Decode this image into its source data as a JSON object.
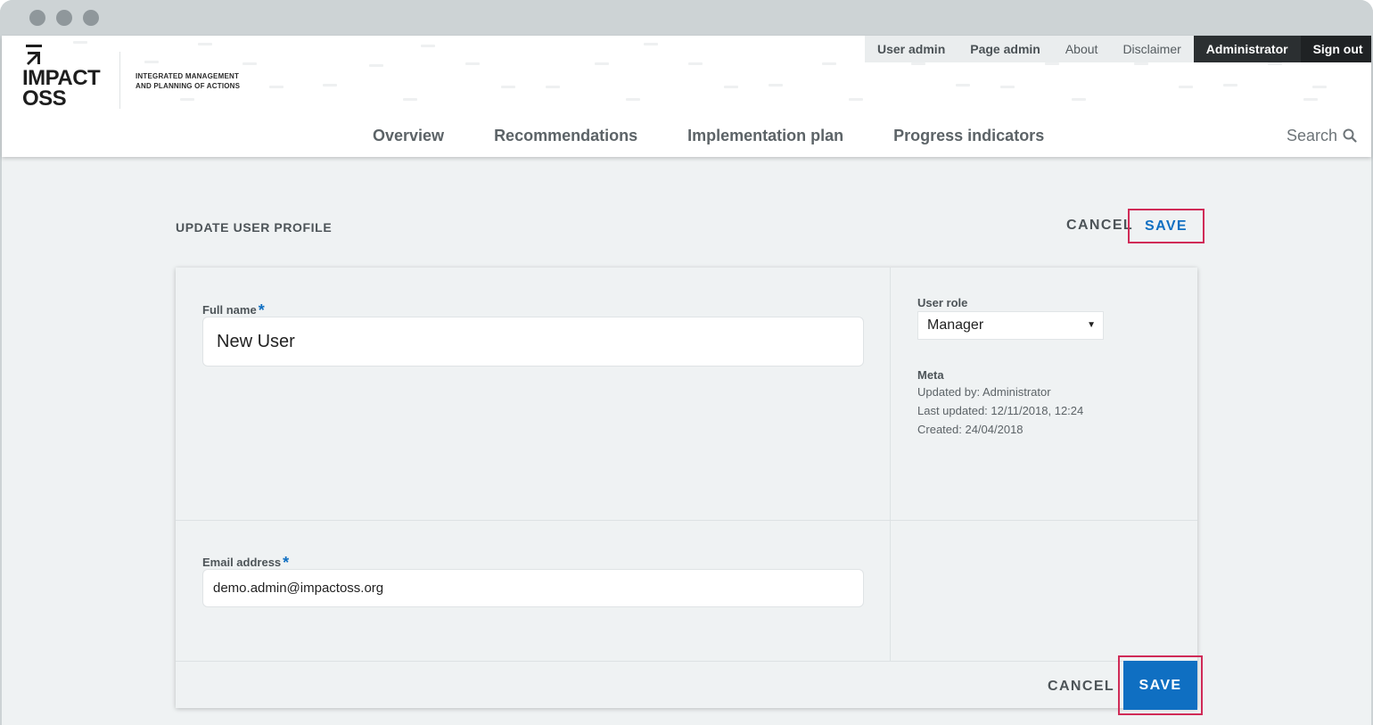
{
  "logo": {
    "name_line1": "IMPACT",
    "name_line2": "OSS",
    "tagline_line1": "INTEGRATED MANAGEMENT",
    "tagline_line2": "AND PLANNING OF ACTIONS"
  },
  "topnav": {
    "user_admin": "User admin",
    "page_admin": "Page admin",
    "about": "About",
    "disclaimer": "Disclaimer",
    "administrator": "Administrator",
    "sign_out": "Sign out"
  },
  "mainnav": {
    "tabs": [
      {
        "label": "Overview"
      },
      {
        "label": "Recommendations"
      },
      {
        "label": "Implementation plan"
      },
      {
        "label": "Progress indicators"
      }
    ],
    "search_label": "Search"
  },
  "page": {
    "title": "UPDATE USER PROFILE",
    "cancel_label": "CANCEL",
    "save_label": "SAVE"
  },
  "form": {
    "full_name": {
      "label": "Full name",
      "required": "*",
      "value": "New User"
    },
    "email": {
      "label": "Email address",
      "required": "*",
      "value": "demo.admin@impactoss.org"
    },
    "user_role": {
      "label": "User role",
      "value": "Manager"
    },
    "meta": {
      "title": "Meta",
      "updated_by": "Updated by: Administrator",
      "last_updated": "Last updated: 12/11/2018, 12:24",
      "created": "Created: 24/04/2018"
    }
  },
  "footer": {
    "cancel_label": "CANCEL",
    "save_label": "SAVE"
  },
  "colors": {
    "accent": "#0f6fc2",
    "highlight": "#d02b57",
    "dark_nav": "#2b2f31"
  }
}
